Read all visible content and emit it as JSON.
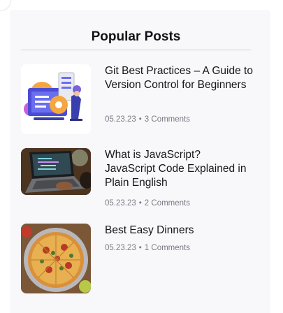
{
  "widget": {
    "title": "Popular Posts"
  },
  "posts": [
    {
      "title": "Git Best Practices – A Guide to Version Control for Beginners",
      "date": "05.23.23",
      "separator": "•",
      "comments": "3 Comments",
      "thumbnail": "git-illustration"
    },
    {
      "title": "What is JavaScript? JavaScript Code Explained in Plain English",
      "date": "05.23.23",
      "separator": "•",
      "comments": "2 Comments",
      "thumbnail": "laptop-code-photo"
    },
    {
      "title": "Best Easy Dinners",
      "date": "05.23.23",
      "separator": "•",
      "comments": "1 Comments",
      "thumbnail": "pizza-photo"
    }
  ],
  "colors": {
    "panel_bg": "#f8f8fb",
    "title_text": "#111217",
    "meta_text": "#7a7b84",
    "divider": "#cfd0d6"
  }
}
